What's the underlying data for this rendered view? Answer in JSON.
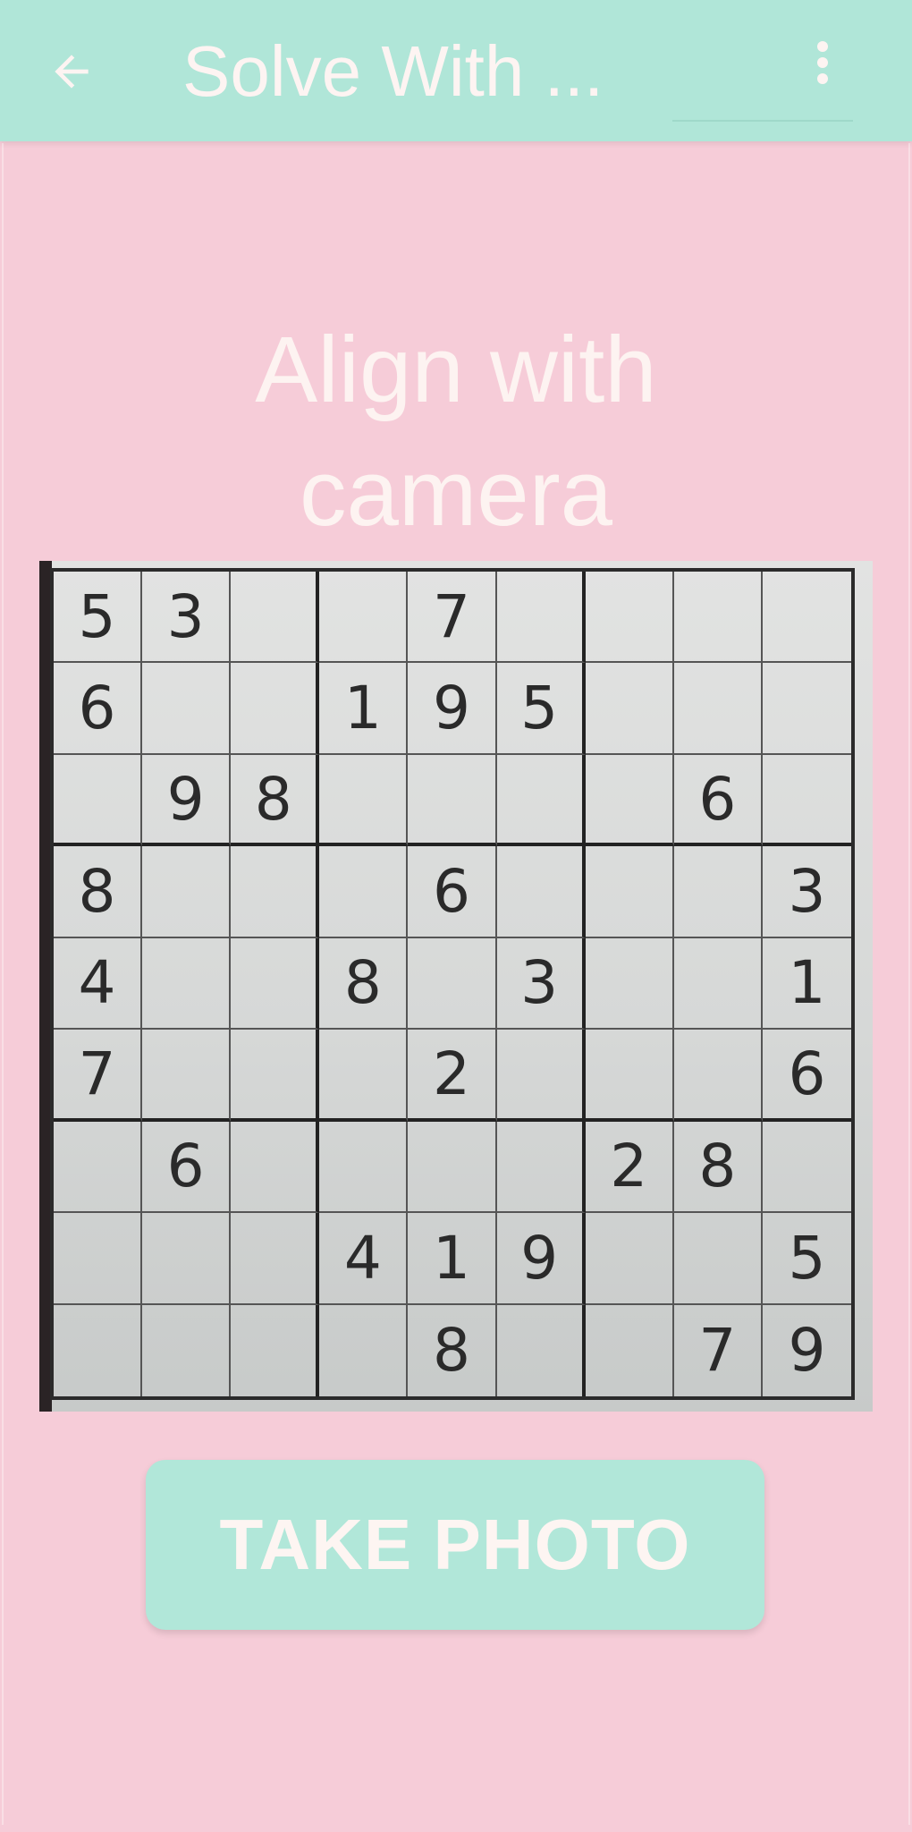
{
  "app_bar": {
    "title": "Solve With ...",
    "back_icon": "arrow-left-icon",
    "menu_icon": "more-vertical-icon",
    "background": "#b0e6d8"
  },
  "instruction": "Align with camera",
  "photo": {
    "grid": [
      [
        "5",
        "3",
        "",
        "",
        "7",
        "",
        "",
        "",
        ""
      ],
      [
        "6",
        "",
        "",
        "1",
        "9",
        "5",
        "",
        "",
        ""
      ],
      [
        "",
        "9",
        "8",
        "",
        "",
        "",
        "",
        "6",
        ""
      ],
      [
        "8",
        "",
        "",
        "",
        "6",
        "",
        "",
        "",
        "3"
      ],
      [
        "4",
        "",
        "",
        "8",
        "",
        "3",
        "",
        "",
        "1"
      ],
      [
        "7",
        "",
        "",
        "",
        "2",
        "",
        "",
        "",
        "6"
      ],
      [
        "",
        "6",
        "",
        "",
        "",
        "",
        "2",
        "8",
        ""
      ],
      [
        "",
        "",
        "",
        "4",
        "1",
        "9",
        "",
        "",
        "5"
      ],
      [
        "",
        "",
        "",
        "",
        "8",
        "",
        "",
        "7",
        "9"
      ]
    ]
  },
  "take_photo_button": "TAKE PHOTO",
  "colors": {
    "page_background": "#f6ccd8",
    "accent": "#b1e7d9",
    "light_text": "#fdf4f2"
  }
}
